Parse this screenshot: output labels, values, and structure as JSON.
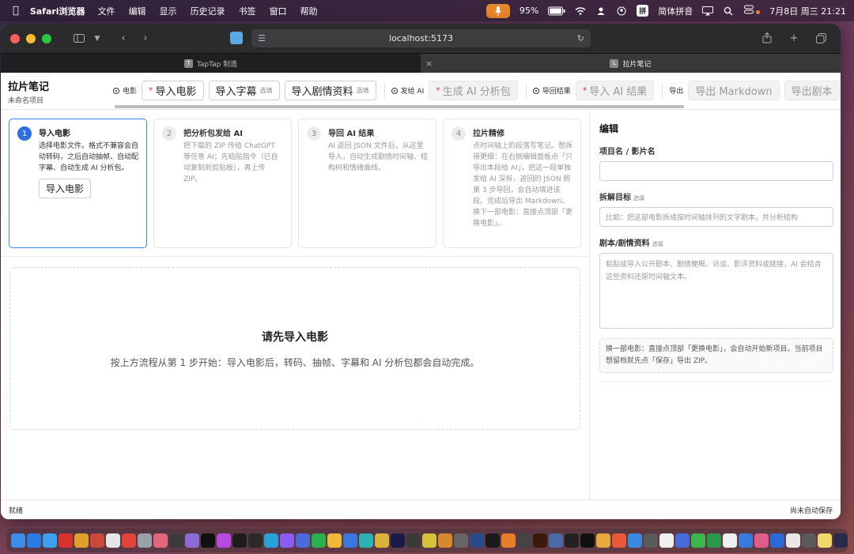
{
  "menubar": {
    "app_name": "Safari浏览器",
    "items": [
      "文件",
      "编辑",
      "显示",
      "历史记录",
      "书签",
      "窗口",
      "帮助"
    ],
    "battery": "95%",
    "ime": "拼",
    "ime_label": "简体拼音",
    "clock": "7月8日 周三  21:21"
  },
  "browser": {
    "url": "localhost:5173",
    "tabs": [
      {
        "label": "TapTap 制造",
        "favicon": "T",
        "active": false
      },
      {
        "label": "拉片笔记",
        "favicon": "L",
        "active": true
      }
    ]
  },
  "app": {
    "title": "拉片笔记",
    "project": "未命名项目",
    "groups": {
      "movie": "电影",
      "send_ai": "发给 AI",
      "import_result": "导回结果",
      "export": "导出"
    },
    "buttons": {
      "import_movie": "导入电影",
      "import_subtitle": "导入字幕",
      "import_script": "导入剧情资料",
      "generate_ai": "生成 AI 分析包",
      "import_ai": "导入 AI 结果",
      "export_md": "导出 Markdown",
      "export_script": "导出剧本"
    },
    "optional_tag": "选填"
  },
  "steps": [
    {
      "num": "1",
      "title": "导入电影",
      "desc": "选择电影文件。格式不兼容会自动转码，之后自动抽帧、自动配字幕、自动生成 AI 分析包。",
      "button": "导入电影",
      "active": true
    },
    {
      "num": "2",
      "title": "把分析包发给 AI",
      "desc": "把下载的 ZIP 传给 ChatGPT 等任意 AI；先粘贴指令（已自动复制到剪贴板），再上传 ZIP。",
      "active": false
    },
    {
      "num": "3",
      "title": "导回 AI 结果",
      "desc": "AI 返回 JSON 文件后，从这里导入，自动生成剧情时间轴、结构树和情绪曲线。",
      "active": false
    },
    {
      "num": "4",
      "title": "拉片精修",
      "desc": "点时间轴上的段落写笔记。想拆得更细：在右侧编辑面板点「只导出本段给 AI」，把这一段单独发给 AI 深拆，返回的 JSON 照第 3 步导回，会自动填进该段。完成后导出 Markdown。换下一部电影：直接点顶部「更换电影」。",
      "active": false
    }
  ],
  "empty": {
    "title": "请先导入电影",
    "subtitle": "按上方流程从第 1 步开始：导入电影后，转码、抽帧、字幕和 AI 分析包都会自动完成。"
  },
  "editor": {
    "title": "编辑",
    "project_label": "项目名 / 影片名",
    "project_value": "",
    "goal_label": "拆解目标",
    "goal_placeholder": "比如：把这部电影拆成按时间轴排列的文字剧本，并分析结构",
    "script_label": "剧本/剧情资料",
    "script_placeholder": "粘贴或导入公开剧本、剧情梗概、访谈、影评资料或链接，AI 会结合这些资料还原时间轴文本。",
    "note": "换一部电影：直接点顶部「更换电影」，会自动开始新项目。当前项目想留档就先点「保存」导出 ZIP。"
  },
  "status": {
    "left": "就绪",
    "right": "尚未自动保存"
  },
  "colors": {
    "accent": "#2f6fdd",
    "required_star": "#e0392b"
  }
}
